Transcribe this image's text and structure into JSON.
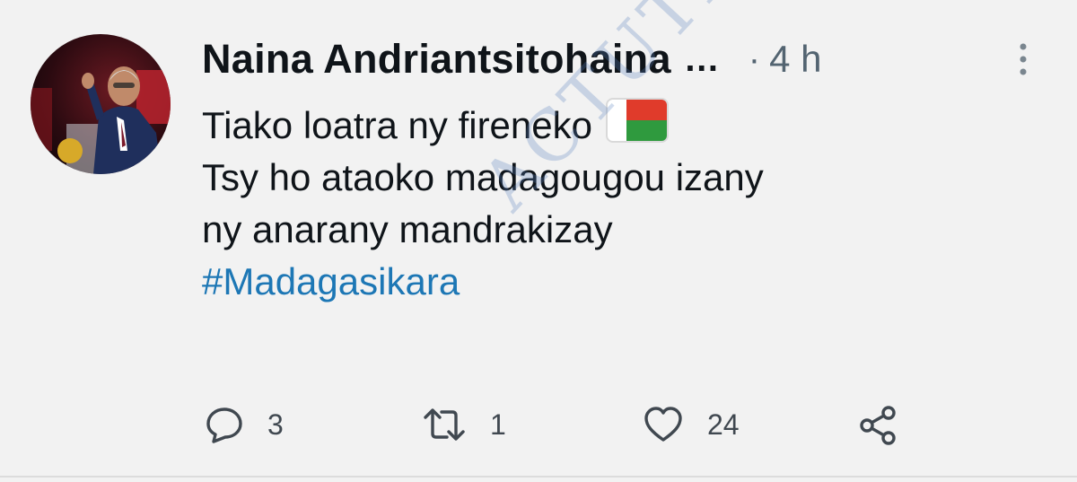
{
  "tweet": {
    "author_name": "Naina Andriantsitohaina",
    "name_ellipsis": "…",
    "separator": "·",
    "time": "4 h",
    "lines": [
      "Tiako loatra ny fireneko",
      "Tsy ho ataoko madagougou izany",
      "ny anarany mandrakizay"
    ],
    "hashtag": "#Madagasikara",
    "flag_emoji": "madagascar-flag-icon"
  },
  "actions": {
    "reply_count": "3",
    "retweet_count": "1",
    "like_count": "24"
  },
  "watermark": "ACTUTIANA.COM",
  "colors": {
    "text": "#0f1419",
    "muted": "#536471",
    "hashtag": "#1d77b5",
    "flag_red": "#e03b2b",
    "flag_green": "#2f9a3e",
    "background": "#f2f2f2"
  }
}
